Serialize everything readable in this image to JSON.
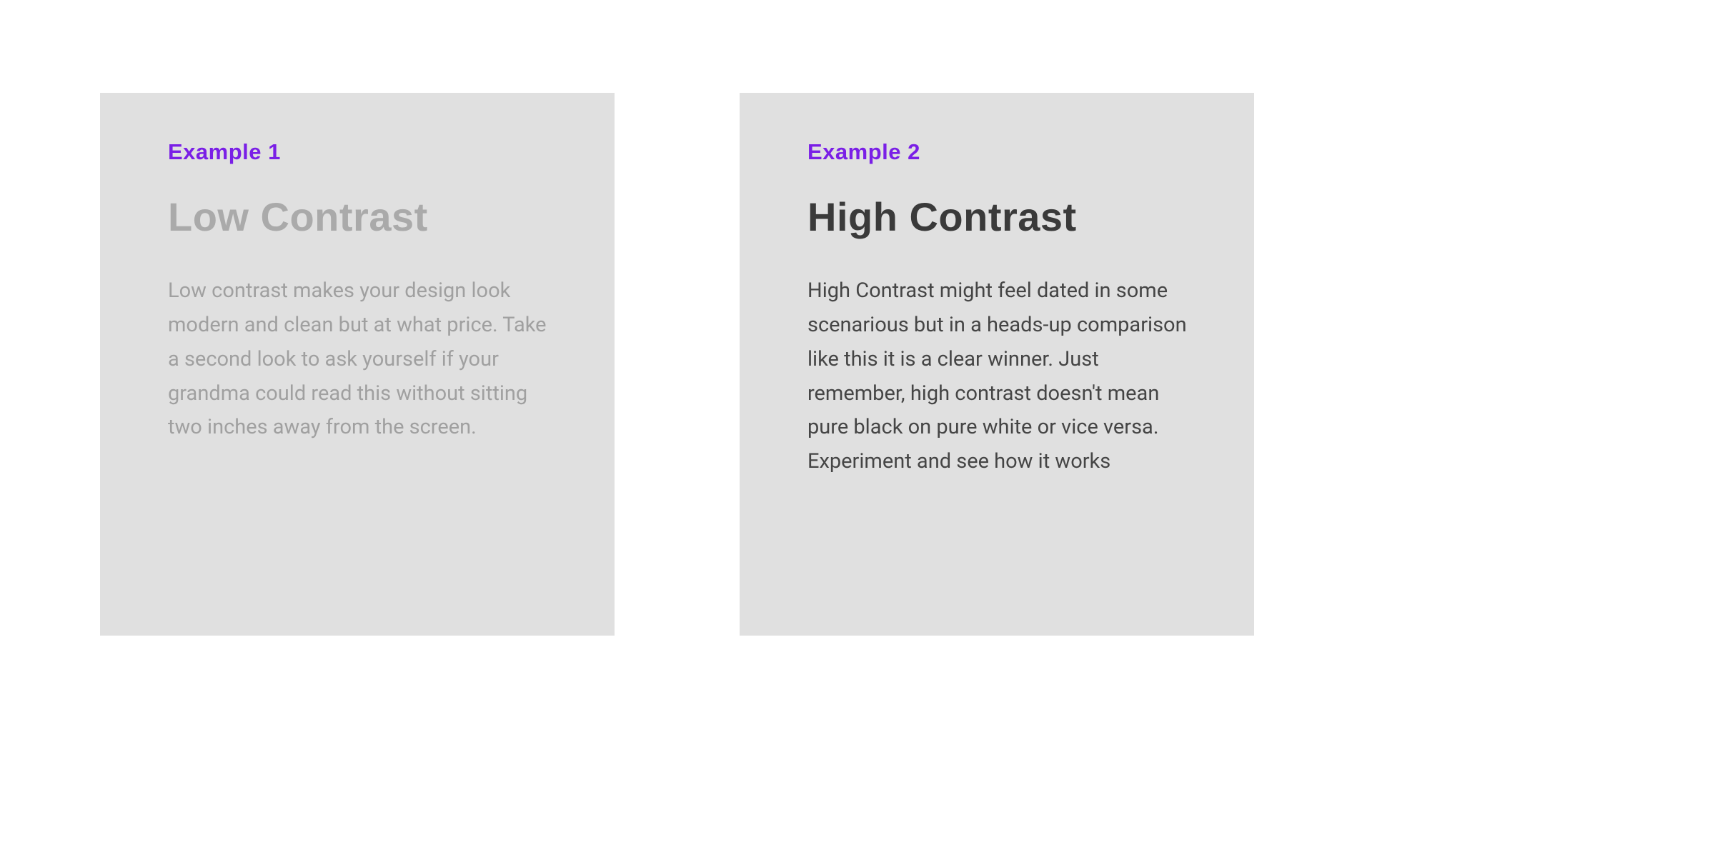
{
  "colors": {
    "accent": "#7a1fe6",
    "card_bg": "#e0e0e0",
    "low_contrast_text": "#a0a0a0",
    "low_contrast_title": "#aaaaaa",
    "high_contrast_text": "#454545",
    "high_contrast_title": "#3a3a3a"
  },
  "cards": [
    {
      "eyebrow": "Example 1",
      "title": "Low Contrast",
      "body": "Low contrast makes your design look modern and clean but at what price. Take a second look to ask yourself if your grandma could read this without sitting two inches away from the screen."
    },
    {
      "eyebrow": "Example 2",
      "title": "High Contrast",
      "body": "High Contrast might feel dated in some scenarious but in a heads-up comparison like this it is a clear winner. Just remember, high contrast doesn't mean pure black on pure white or vice versa. Experiment and see how it works"
    }
  ]
}
